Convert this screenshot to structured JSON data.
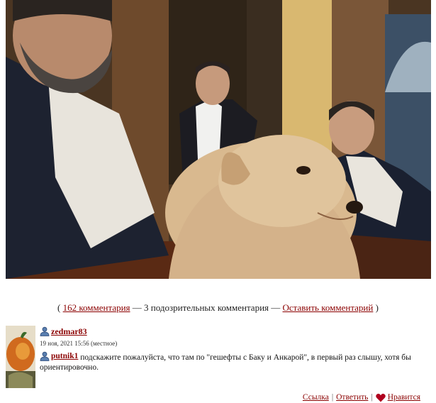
{
  "comments_summary": {
    "open_paren": "(",
    "count_link": "162 комментария",
    "middle_text": "— 3 подозрительных комментария —",
    "leave_link": "Оставить комментарий",
    "close_paren": ")"
  },
  "comment": {
    "author": "zedmar83",
    "date": "19 ноя, 2021 15:56 (местное)",
    "reply_to": "putnik1",
    "text": "подскажите пожалуйста, что там по \"гешефты с Баку и Анкарой\", в первый раз слышу, хотя бы ориентировочно."
  },
  "actions": {
    "link_label": "Ссылка",
    "sep": "|",
    "reply_label": "Ответить",
    "like_label": "Нравится",
    "heart_color": "#b0001e"
  },
  "icons": {
    "user": "user-icon",
    "heart": "heart-icon"
  },
  "colors": {
    "link": "#8b0000"
  }
}
